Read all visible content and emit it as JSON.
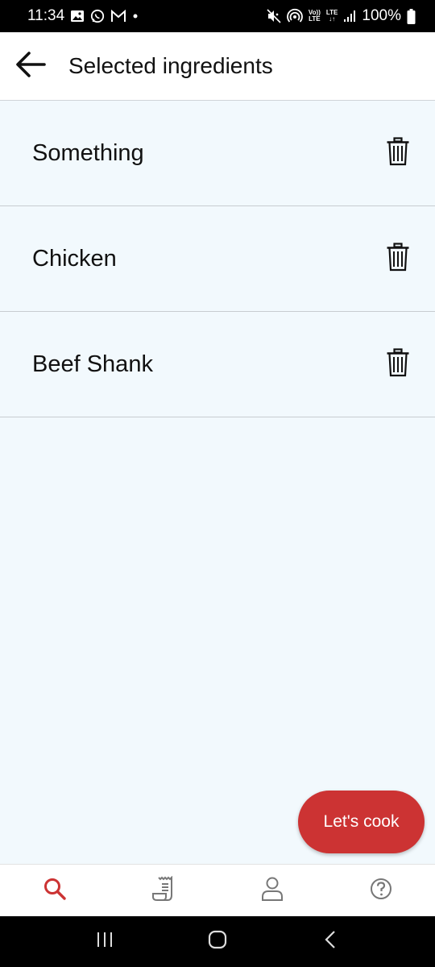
{
  "status_bar": {
    "time": "11:34",
    "left_icons": [
      "gallery-icon",
      "whatsapp-icon",
      "gmail-icon",
      "dot-icon"
    ],
    "right_icons": [
      "mute-icon",
      "hotspot-icon",
      "volte-icon",
      "lte-icon",
      "signal-icon",
      "battery-icon"
    ],
    "volte_top": "Vo))",
    "volte_bottom": "LTE",
    "lte_top": "LTE",
    "lte_bottom": "↓↑",
    "battery": "100%"
  },
  "app_bar": {
    "back_icon": "arrow-left-icon",
    "title": "Selected ingredients"
  },
  "ingredients": [
    {
      "name": "Something",
      "icon": "trash-icon"
    },
    {
      "name": "Chicken",
      "icon": "trash-icon"
    },
    {
      "name": "Beef Shank",
      "icon": "trash-icon"
    }
  ],
  "fab": {
    "label": "Let's cook",
    "color": "#cc3333"
  },
  "bottom_nav": {
    "items": [
      {
        "icon": "search-icon",
        "active": true
      },
      {
        "icon": "recipe-icon",
        "active": false
      },
      {
        "icon": "profile-icon",
        "active": false
      },
      {
        "icon": "help-icon",
        "active": false
      }
    ],
    "active_color": "#cc3333",
    "inactive_color": "#777777"
  },
  "system_nav": {
    "icons": [
      "recents-icon",
      "home-icon",
      "back-icon"
    ]
  },
  "colors": {
    "background": "#f2f9fd",
    "divider": "#c8ccd0",
    "accent": "#cc3333"
  }
}
